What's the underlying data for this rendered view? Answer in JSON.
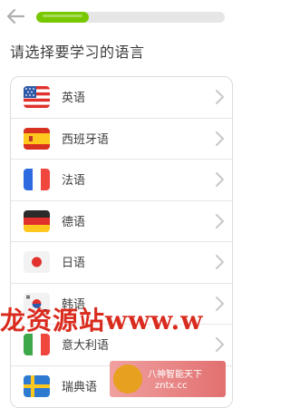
{
  "header": {
    "back_icon": "arrow-left-icon",
    "progress_fraction": 0.28
  },
  "title": "请选择要学习的语言",
  "languages": [
    {
      "label": "英语",
      "flag": "us-flag-icon"
    },
    {
      "label": "西班牙语",
      "flag": "spain-flag-icon"
    },
    {
      "label": "法语",
      "flag": "france-flag-icon"
    },
    {
      "label": "德语",
      "flag": "germany-flag-icon"
    },
    {
      "label": "日语",
      "flag": "japan-flag-icon"
    },
    {
      "label": "韩语",
      "flag": "korea-flag-icon"
    },
    {
      "label": "意大利语",
      "flag": "italy-flag-icon"
    },
    {
      "label": "瑞典语",
      "flag": "sweden-flag-icon"
    }
  ],
  "watermark": {
    "text": "龙资源站www.w",
    "badge_line1": "八神智能天下",
    "badge_line2": "zntx.cc"
  },
  "colors": {
    "accent_green": "#78c800",
    "watermark_red": "#d92b1e"
  }
}
